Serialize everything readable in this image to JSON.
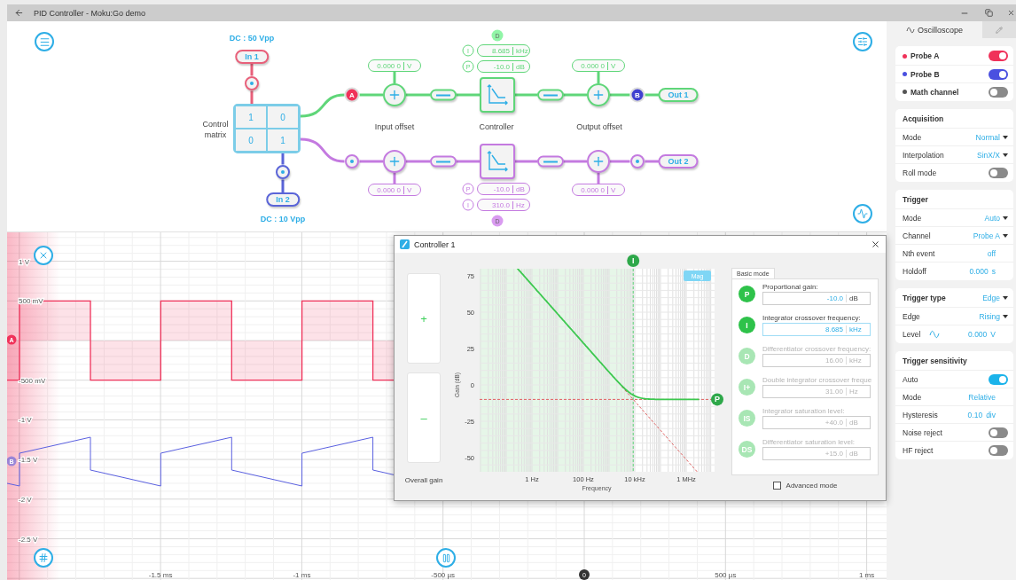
{
  "window": {
    "title": "PID Controller - Moku:Go demo"
  },
  "diagram": {
    "inputs": [
      {
        "label": "In 1",
        "coupling": "DC : 50 Vpp",
        "color": "#e8607a"
      },
      {
        "label": "In 2",
        "coupling": "DC : 10 Vpp",
        "color": "#5a64d8"
      }
    ],
    "matrix": {
      "label": "Control matrix",
      "cells": [
        "1",
        "0",
        "0",
        "1"
      ]
    },
    "stage_labels": [
      "Input offset",
      "Controller",
      "Output offset"
    ],
    "channels": [
      {
        "color": "#5fd679",
        "switches": [
          {
            "on": false
          },
          {
            "on": false
          }
        ],
        "input_probe": {
          "label": "A",
          "color": "#f0325a"
        },
        "input_offset": {
          "value": "0.000 0",
          "unit": "V"
        },
        "params": [
          {
            "letter": "I",
            "value": "8.685",
            "unit": "kHz"
          },
          {
            "letter": "P",
            "value": "-10.0",
            "unit": "dB"
          }
        ],
        "d_badge": "D",
        "output_offset": {
          "value": "0.000 0",
          "unit": "V"
        },
        "output_probe": {
          "label": "B",
          "color": "#4040d0"
        },
        "output": "Out 1"
      },
      {
        "color": "#c47ae0",
        "switches": [
          {
            "on": false
          },
          {
            "on": false
          }
        ],
        "input_offset": {
          "value": "0.000 0",
          "unit": "V"
        },
        "params": [
          {
            "letter": "P",
            "value": "-10.0",
            "unit": "dB"
          },
          {
            "letter": "I",
            "value": "310.0",
            "unit": "Hz"
          }
        ],
        "d_badge": "D",
        "output_offset": {
          "value": "0.000 0",
          "unit": "V"
        },
        "output": "Out 2"
      }
    ]
  },
  "scope": {
    "y_ticks": [
      "1 V",
      "500 mV",
      "-500 mV",
      "-1 V",
      "-1.5 V",
      "-2 V",
      "-2.5 V"
    ],
    "x_ticks": [
      "-1.5 ms",
      "-1 ms",
      "-500 µs",
      "500 µs",
      "1 ms"
    ],
    "zero_marker": "0",
    "traces": [
      {
        "label": "A",
        "color": "#f0325a"
      },
      {
        "label": "B",
        "color": "#5a60e0"
      }
    ]
  },
  "controller_dialog": {
    "title": "Controller 1",
    "gain_buttons": [
      "+",
      "–"
    ],
    "gain_label": "Overall gain",
    "plot": {
      "mode_button": "Mag",
      "ylabel": "Gain (dB)",
      "xlabel": "Frequency",
      "yticks": [
        "75",
        "50",
        "25",
        "0",
        "-25",
        "-50"
      ],
      "xticks": [
        "1 Hz",
        "100 Hz",
        "10 kHz",
        "1 MHz"
      ],
      "markers": [
        "I",
        "P"
      ]
    },
    "tab": "Basic mode",
    "params": [
      {
        "badge": "P",
        "label": "Proportional gain:",
        "value": "-10.0",
        "unit": "dB",
        "enabled": true,
        "selected": false
      },
      {
        "badge": "I",
        "label": "Integrator crossover frequency:",
        "value": "8.685",
        "unit": "kHz",
        "enabled": true,
        "selected": true
      },
      {
        "badge": "D",
        "label": "Differentiator crossover frequency:",
        "value": "16.00",
        "unit": "kHz",
        "enabled": false,
        "selected": false
      },
      {
        "badge": "I+",
        "label": "Double integrator crossover freque",
        "value": "31.00",
        "unit": "Hz",
        "enabled": false,
        "selected": false
      },
      {
        "badge": "IS",
        "label": "Integrator saturation level:",
        "value": "+40.0",
        "unit": "dB",
        "enabled": false,
        "selected": false
      },
      {
        "badge": "DS",
        "label": "Differentiator saturation level:",
        "value": "+15.0",
        "unit": "dB",
        "enabled": false,
        "selected": false
      }
    ],
    "advanced": {
      "label": "Advanced mode",
      "checked": false
    }
  },
  "panel": {
    "tabs": [
      {
        "kind": "scope",
        "label": "Oscilloscope",
        "selected": true
      },
      {
        "kind": "edit",
        "selected": false
      }
    ],
    "probes": [
      {
        "label": "Probe A",
        "color": "#f0325a",
        "on": true
      },
      {
        "label": "Probe B",
        "color": "#4a50e0",
        "on": true
      },
      {
        "label": "Math channel",
        "color": "#555555",
        "on": false
      }
    ],
    "sections": [
      {
        "title": "Acquisition",
        "rows": [
          {
            "kind": "select",
            "label": "Mode",
            "value": "Normal"
          },
          {
            "kind": "select",
            "label": "Interpolation",
            "value": "SinX/X"
          },
          {
            "kind": "toggle",
            "label": "Roll mode",
            "on": false
          }
        ]
      },
      {
        "title": "Trigger",
        "rows": [
          {
            "kind": "select",
            "label": "Mode",
            "value": "Auto"
          },
          {
            "kind": "select",
            "label": "Channel",
            "value": "Probe A"
          },
          {
            "kind": "value",
            "label": "Nth event",
            "value": "off"
          },
          {
            "kind": "value",
            "label": "Holdoff",
            "value": "0.000",
            "unit": "s"
          }
        ]
      },
      {
        "title": "Trigger type",
        "title_value": "Edge",
        "rows": [
          {
            "kind": "select",
            "label": "Edge",
            "value": "Rising"
          },
          {
            "kind": "level",
            "label": "Level",
            "value": "0.000",
            "unit": "V"
          }
        ]
      },
      {
        "title": "Trigger sensitivity",
        "rows": [
          {
            "kind": "toggle",
            "label": "Auto",
            "on": true
          },
          {
            "kind": "value",
            "label": "Mode",
            "value": "Relative"
          },
          {
            "kind": "value",
            "label": "Hysteresis",
            "value": "0.10",
            "unit": "div"
          },
          {
            "kind": "toggle",
            "label": "Noise reject",
            "on": false
          },
          {
            "kind": "toggle",
            "label": "HF reject",
            "on": false
          }
        ]
      }
    ]
  }
}
